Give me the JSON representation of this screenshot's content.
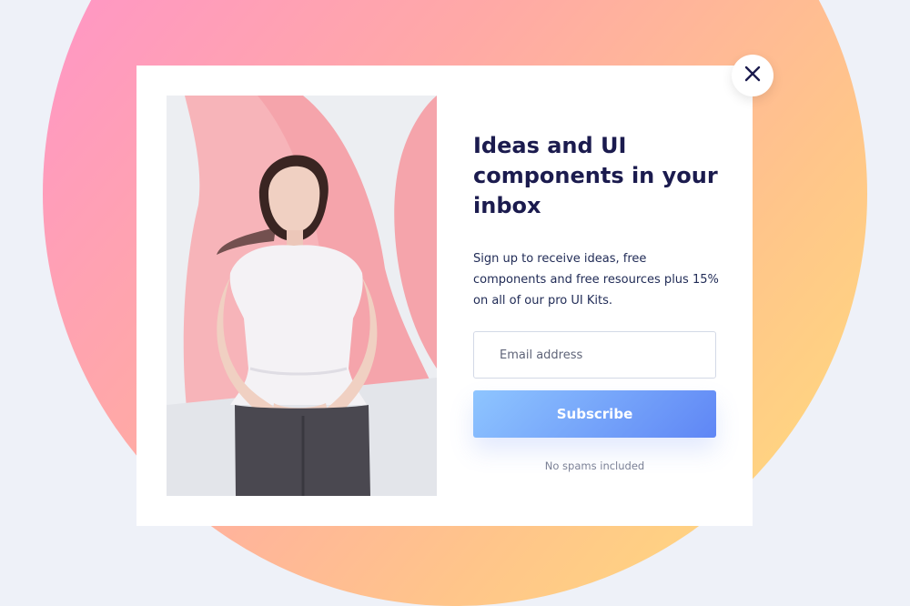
{
  "modal": {
    "title": "Ideas and UI components in your inbox",
    "description": "Sign up to receive ideas, free components and free resources plus 15% on all of our pro UI Kits.",
    "email": {
      "placeholder": "Email address",
      "value": ""
    },
    "subscribe_label": "Subscribe",
    "note": "No spams included",
    "close_icon": "close-icon",
    "photo": "woman-in-white-blouse-photo"
  },
  "colors": {
    "title": "#1b1b4e",
    "button_start": "#8ec5ff",
    "button_end": "#5f86f5",
    "circle_pink": "#ff8fd2",
    "circle_yellow": "#ffe07a",
    "page_bg": "#eef1f8"
  }
}
